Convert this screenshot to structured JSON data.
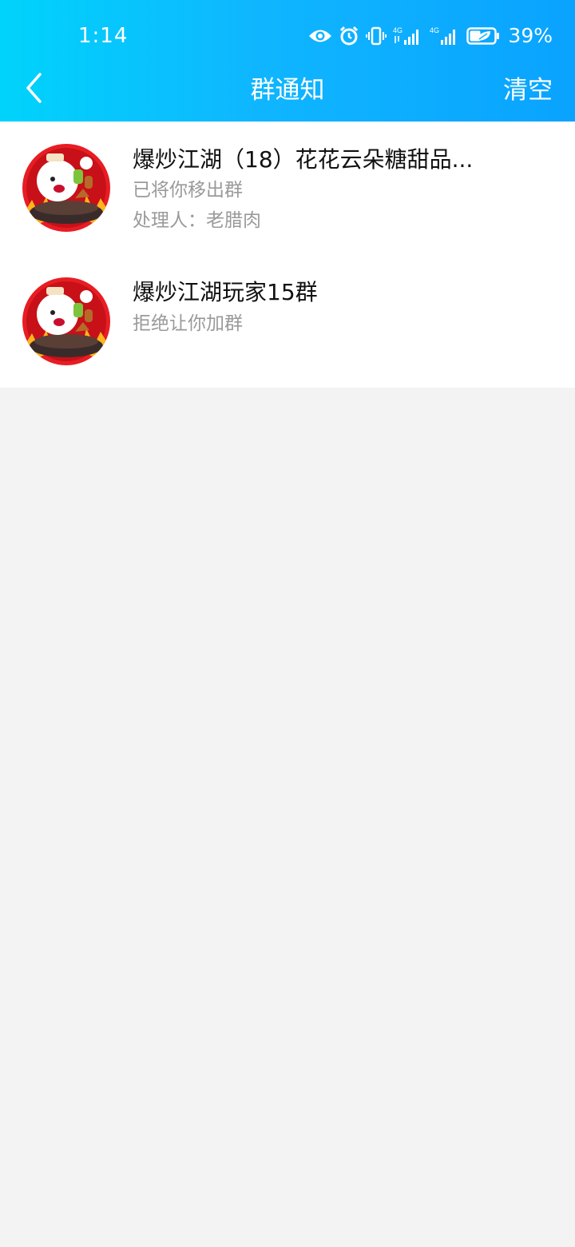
{
  "status_bar": {
    "time": "1:14",
    "signal1_label": "4G",
    "signal2_label": "4G",
    "battery_percent": "39%",
    "icons": [
      "eye-icon",
      "alarm-icon",
      "vibrate-icon",
      "signal-4g-icon",
      "signal-4g-icon",
      "battery-saver-icon"
    ]
  },
  "header": {
    "title": "群通知",
    "back_icon": "chevron-left-icon",
    "clear_label": "清空",
    "gradient_start": "#00d3fb",
    "gradient_end": "#0aa3ff"
  },
  "notifications": [
    {
      "group_name": "爆炒江湖（18）花花云朵糖甜品...",
      "message": "已将你移出群",
      "handler": "处理人：老腊肉",
      "avatar": "game-mascot-avatar"
    },
    {
      "group_name": "爆炒江湖玩家15群",
      "message": "拒绝让你加群",
      "avatar": "game-mascot-avatar"
    }
  ],
  "colors": {
    "page_bg": "#f3f3f3",
    "list_bg": "#ffffff",
    "title_text": "#111111",
    "secondary_text": "#9a9a9a"
  }
}
